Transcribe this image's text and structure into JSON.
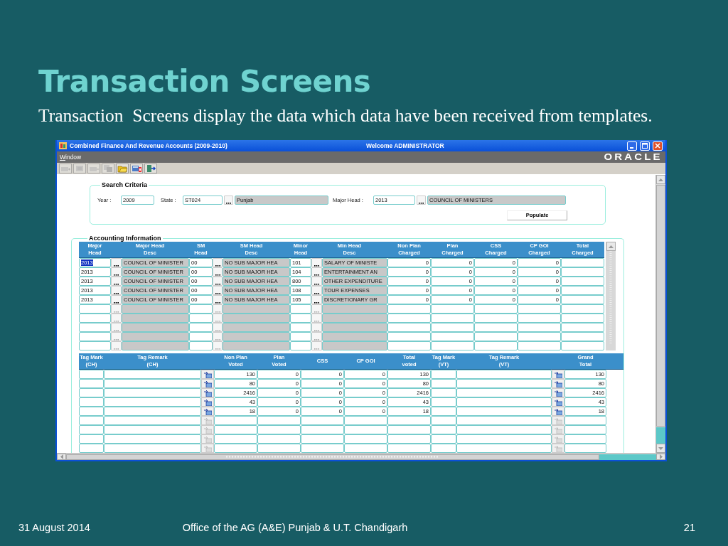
{
  "slide": {
    "title": "Transaction Screens",
    "body": "Transaction  Screens display the data which data have been received from templates.",
    "footer": {
      "date": "31 August 2014",
      "office": "Office of the AG (A&E) Punjab & U.T. Chandigarh",
      "page": "21"
    }
  },
  "app": {
    "window": {
      "title": "Combined Finance And Revenue Accounts (2009-2010)",
      "welcome": "Welcome  ADMINISTRATOR"
    },
    "menu": [
      "Window"
    ],
    "logo": "ORACLE",
    "toolbar": [
      {
        "kind": "add",
        "disabled": true
      },
      {
        "kind": "edit",
        "disabled": true
      },
      {
        "kind": "delete",
        "disabled": true
      },
      {
        "kind": "copy",
        "disabled": true
      },
      {
        "kind": "open",
        "disabled": false
      },
      {
        "kind": "help",
        "disabled": false
      },
      {
        "kind": "exit",
        "disabled": false
      }
    ],
    "search": {
      "title": "Search Criteria",
      "year_label": "Year :",
      "year": "2009",
      "state_label": "State :",
      "state": "ST024",
      "state_name": "Punjab",
      "major_head_label": "Major Head :",
      "major_head": "2013",
      "major_head_name": "COUNCIL OF MINISTERS",
      "populate": "Populate"
    },
    "accounting": {
      "title": "Accounting Information",
      "charged": {
        "columns": [
          "Major\nHead",
          "Major Head\nDesc",
          "SM\nHead",
          "SM Head\nDesc",
          "Minor\nHead",
          "Min Head\nDesc",
          "Non Plan\nCharged",
          "Plan\nCharged",
          "CSS\nCharged",
          "CP GOI\nCharged",
          "Total\nCharged"
        ],
        "rows": [
          {
            "major_head": "2013",
            "major_head_desc": "COUNCIL OF MINISTER",
            "sm_head": "00",
            "sm_head_desc": "NO SUB MAJOR HEA",
            "minor_head": "101",
            "min_head_desc": "SALARY OF MINISTE",
            "non_plan_charged": "0",
            "plan_charged": "0",
            "css_charged": "0",
            "cp_goi_charged": "0",
            "disabled": false,
            "focused": true
          },
          {
            "major_head": "2013",
            "major_head_desc": "COUNCIL OF MINISTER",
            "sm_head": "00",
            "sm_head_desc": "NO SUB MAJOR HEA",
            "minor_head": "104",
            "min_head_desc": "ENTERTAINMENT AN",
            "non_plan_charged": "0",
            "plan_charged": "0",
            "css_charged": "0",
            "cp_goi_charged": "0",
            "disabled": false,
            "focused": false
          },
          {
            "major_head": "2013",
            "major_head_desc": "COUNCIL OF MINISTER",
            "sm_head": "00",
            "sm_head_desc": "NO SUB MAJOR HEA",
            "minor_head": "800",
            "min_head_desc": "OTHER EXPENDITURE",
            "non_plan_charged": "0",
            "plan_charged": "0",
            "css_charged": "0",
            "cp_goi_charged": "0",
            "disabled": false,
            "focused": false
          },
          {
            "major_head": "2013",
            "major_head_desc": "COUNCIL OF MINISTER",
            "sm_head": "00",
            "sm_head_desc": "NO SUB MAJOR HEA",
            "minor_head": "108",
            "min_head_desc": "TOUR EXPENSES",
            "non_plan_charged": "0",
            "plan_charged": "0",
            "css_charged": "0",
            "cp_goi_charged": "0",
            "disabled": false,
            "focused": false
          },
          {
            "major_head": "2013",
            "major_head_desc": "COUNCIL OF MINISTER",
            "sm_head": "00",
            "sm_head_desc": "NO SUB MAJOR HEA",
            "minor_head": "105",
            "min_head_desc": "DISCRETIONARY GR",
            "non_plan_charged": "0",
            "plan_charged": "0",
            "css_charged": "0",
            "cp_goi_charged": "0",
            "disabled": false,
            "focused": false
          },
          {
            "disabled": true,
            "focused": false
          },
          {
            "disabled": true,
            "focused": false
          },
          {
            "disabled": true,
            "focused": false
          },
          {
            "disabled": true,
            "focused": false
          },
          {
            "disabled": true,
            "focused": false
          }
        ]
      },
      "voted": {
        "columns": [
          "Tag Mark\n(CH)",
          "Tag Remark\n(CH)",
          "Non Plan\nVoted",
          "Plan\nVoted",
          "CSS",
          "CP GOI",
          "Total\nvoted",
          "Tag Mark\n(VT)",
          "Tag Remark\n(VT)",
          "Grand\nTotal"
        ],
        "rows": [
          {
            "non_plan_voted": "130",
            "plan_voted": "0",
            "css": "0",
            "cp_goi": "0",
            "total_voted": "130",
            "grand_total": "130",
            "disabled": false
          },
          {
            "non_plan_voted": "80",
            "plan_voted": "0",
            "css": "0",
            "cp_goi": "0",
            "total_voted": "80",
            "grand_total": "80",
            "disabled": false
          },
          {
            "non_plan_voted": "2416",
            "plan_voted": "0",
            "css": "0",
            "cp_goi": "0",
            "total_voted": "2416",
            "grand_total": "2416",
            "disabled": false
          },
          {
            "non_plan_voted": "43",
            "plan_voted": "0",
            "css": "0",
            "cp_goi": "0",
            "total_voted": "43",
            "grand_total": "43",
            "disabled": false
          },
          {
            "non_plan_voted": "18",
            "plan_voted": "0",
            "css": "0",
            "cp_goi": "0",
            "total_voted": "18",
            "grand_total": "18",
            "disabled": false
          },
          {
            "disabled": true
          },
          {
            "disabled": true
          },
          {
            "disabled": true
          },
          {
            "disabled": true
          }
        ]
      }
    }
  }
}
